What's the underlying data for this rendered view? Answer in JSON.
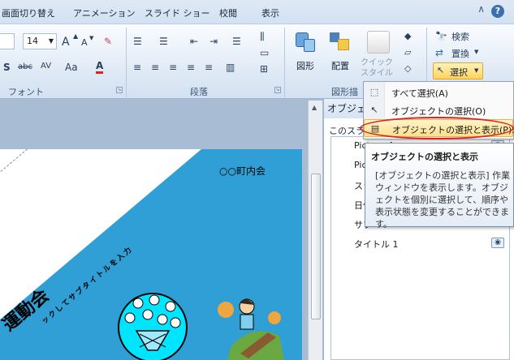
{
  "tabs": [
    "画面切り替え",
    "アニメーション",
    "スライド ショー",
    "校閲",
    "表示"
  ],
  "help_icon": "?",
  "font_group": {
    "font_size": "14",
    "grow_font": "A",
    "shrink_font": "A",
    "label": "フォント",
    "buttons": [
      "S",
      "abc",
      "AV",
      "Aa",
      "A"
    ]
  },
  "paragraph_group": {
    "label": "段落"
  },
  "drawing_group": {
    "shapes_label": "図形",
    "arrange_label": "配置",
    "quick_style_label": "クイック\nスタイル",
    "label": "図形描"
  },
  "editing_group": {
    "find_label": "検索",
    "replace_label": "置換",
    "select_label": "選択"
  },
  "slide": {
    "town_text": "○○町内会",
    "title_text": "運動会",
    "subtitle_text": "ックしてサブタイトルを入力"
  },
  "selection_pane": {
    "header": "オブジェクト",
    "sub": "このスラ",
    "items": [
      "Picture 4",
      "Pic",
      "スラ",
      "日付",
      "サブ",
      "タイトル 1"
    ]
  },
  "menu": {
    "items": [
      "すべて選択(A)",
      "オブジェクトの選択(O)",
      "オブジェクトの選択と表示(P)..."
    ]
  },
  "tooltip": {
    "title": "オブジェクトの選択と表示",
    "body": "[オブジェクトの選択と表示] 作業ウィンドウを表示します。オブジェクトを個別に選択して、順序や表示状態を変更することができます。"
  },
  "colors": {
    "slide_blue": "#2f9fd5",
    "highlight_ring": "#e02020",
    "menu_highlight": "#ffe08c"
  }
}
